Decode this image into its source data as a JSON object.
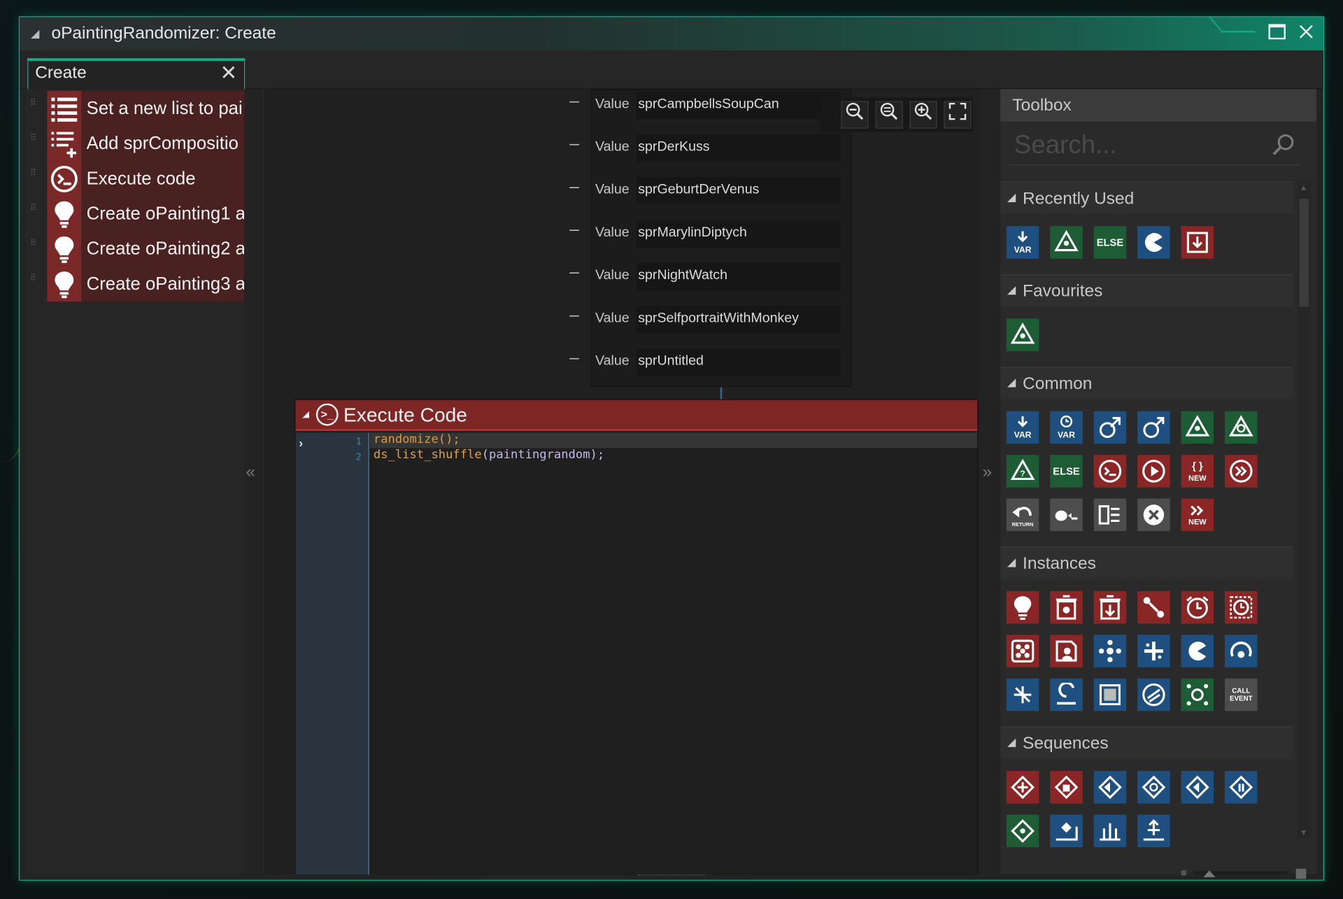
{
  "window": {
    "title": "oPaintingRandomizer: Create"
  },
  "tab": {
    "label": "Create",
    "close": "✕"
  },
  "events": [
    {
      "label": "Set a new list to pai",
      "icon": "list-icon"
    },
    {
      "label": "Add sprCompositio",
      "icon": "list-add-icon"
    },
    {
      "label": "Execute code",
      "icon": "code-icon"
    },
    {
      "label": "Create oPainting1 a",
      "icon": "lightbulb-icon"
    },
    {
      "label": "Create oPainting2 a",
      "icon": "lightbulb-icon"
    },
    {
      "label": "Create oPainting3 a",
      "icon": "lightbulb-icon"
    }
  ],
  "values": [
    {
      "label": "Value",
      "value": "sprCampbellsSoupCan"
    },
    {
      "label": "Value",
      "value": "sprDerKuss"
    },
    {
      "label": "Value",
      "value": "sprGeburtDerVenus"
    },
    {
      "label": "Value",
      "value": "sprMarylinDiptych"
    },
    {
      "label": "Value",
      "value": "sprNightWatch"
    },
    {
      "label": "Value",
      "value": "sprSelfportraitWithMonkey"
    },
    {
      "label": "Value",
      "value": "sprUntitled"
    }
  ],
  "code_node": {
    "title": "Execute Code",
    "line_numbers": [
      "1",
      "2"
    ],
    "lines": [
      "randomize();",
      "ds_list_shuffle(paintingrandom);"
    ]
  },
  "toolbox": {
    "title": "Toolbox",
    "search_placeholder": "Search...",
    "sections": {
      "recently_used": "Recently Used",
      "favourites": "Favourites",
      "common": "Common",
      "instances": "Instances",
      "sequences": "Sequences"
    },
    "icon_labels": {
      "var": "VAR",
      "else": "ELSE",
      "new": "NEW",
      "return": "RETURN",
      "call_event": "CALL EVENT"
    }
  },
  "colors": {
    "accent": "#0fb090",
    "event_red": "#7a2828",
    "code_header": "#7e2525",
    "blue": "#1e4f7e",
    "green": "#1d5c35"
  }
}
